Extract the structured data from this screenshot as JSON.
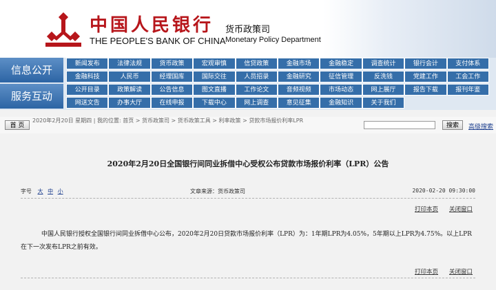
{
  "header": {
    "cn_name": "中国人民银行",
    "en_name": "THE PEOPLE'S BANK OF CHINA",
    "dept_cn": "货币政策司",
    "dept_en": "Monetary Policy Department",
    "logo_icon": "pboc-logo-icon",
    "colors": {
      "brand_red": "#b7161b",
      "nav_blue": "#356ea9",
      "banner_blue": "#0a4a8c"
    }
  },
  "nav": {
    "group1_label": "信息公开",
    "group2_label": "服务互动",
    "row1": [
      "新闻发布",
      "法律法规",
      "货币政策",
      "宏观审慎",
      "信贷政策",
      "金融市场",
      "金融稳定",
      "调查统计",
      "银行会计",
      "支付体系"
    ],
    "row2": [
      "金融科技",
      "人民币",
      "经理国库",
      "国际交往",
      "人员招录",
      "金融研究",
      "征信管理",
      "反洗钱",
      "党建工作",
      "工会工作"
    ],
    "row3": [
      "公开目录",
      "政策解读",
      "公告信息",
      "图文直播",
      "工作论文",
      "音频视频",
      "市场动态",
      "网上展厅",
      "报告下载",
      "报刊年鉴"
    ],
    "row4": [
      "网送文告",
      "办事大厅",
      "在线申报",
      "下载中心",
      "网上调查",
      "意见征集",
      "金融知识",
      "关于我们"
    ]
  },
  "crumb": {
    "home_button": "首 页",
    "text": "2020年2月20日 星期四 | 我的位置: 首页 > 货币政策司 > 货币政策工具 > 利率政策 > 贷款市场报价利率LPR",
    "search_button": "搜索",
    "advanced_search": "高级搜索"
  },
  "article": {
    "title": "2020年2月20日全国银行间同业拆借中心受权公布贷款市场报价利率（LPR）公告",
    "font_label": "字号",
    "font_large": "大",
    "font_medium": "中",
    "font_small": "小",
    "source": "文章来源：货币政策司",
    "datetime": "2020-02-20  09:30:00",
    "print": "打印本页",
    "close": "关闭窗口",
    "body": "中国人民银行授权全国银行间同业拆借中心公布，2020年2月20日贷款市场报价利率（LPR）为：1年期LPR为4.05%，5年期以上LPR为4.75%。以上LPR在下一次发布LPR之前有效。"
  }
}
